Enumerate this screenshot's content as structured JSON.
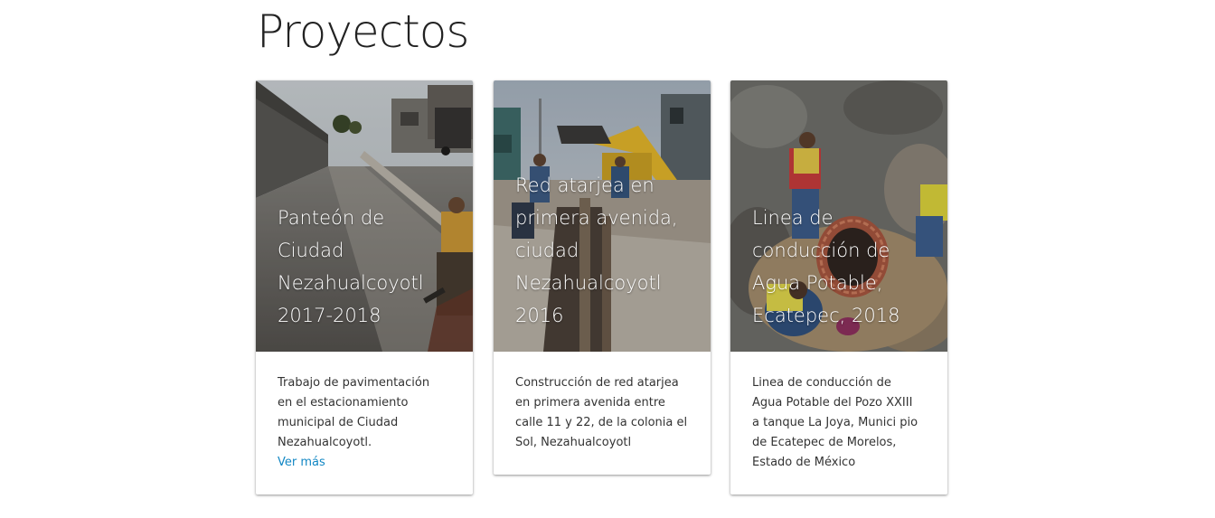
{
  "page": {
    "title": "Proyectos"
  },
  "cards": [
    {
      "title_lines": [
        "Panteón de",
        "Ciudad",
        "Nezahualcoyotl",
        "2017-2018"
      ],
      "description_lines": [
        "Trabajo de pavimentación",
        "en el estacionamiento",
        "municipal de Ciudad",
        "Nezahualcoyotl."
      ],
      "link": "Ver más"
    },
    {
      "title_lines": [
        "Red atarjea en",
        "primera avenida,",
        "ciudad",
        "Nezahualcoyotl",
        "2016"
      ],
      "description_lines": [
        "Construcción de red atarjea",
        "en primera avenida entre",
        "calle 11 y 22, de la colonia el",
        "Sol, Nezahualcoyotl"
      ]
    },
    {
      "title_lines": [
        "Linea de",
        "conducción de",
        "Agua Potable,",
        "Ecatepec, 2018"
      ],
      "description_lines": [
        "Linea de conducción de",
        "Agua Potable del Pozo XXIII",
        "a tanque La Joya, Munici pio",
        "de Ecatepec de Morelos,",
        "Estado de México"
      ]
    }
  ],
  "colors": {
    "link": "#1287c4",
    "heading": "#222222",
    "body_text": "#333333"
  }
}
